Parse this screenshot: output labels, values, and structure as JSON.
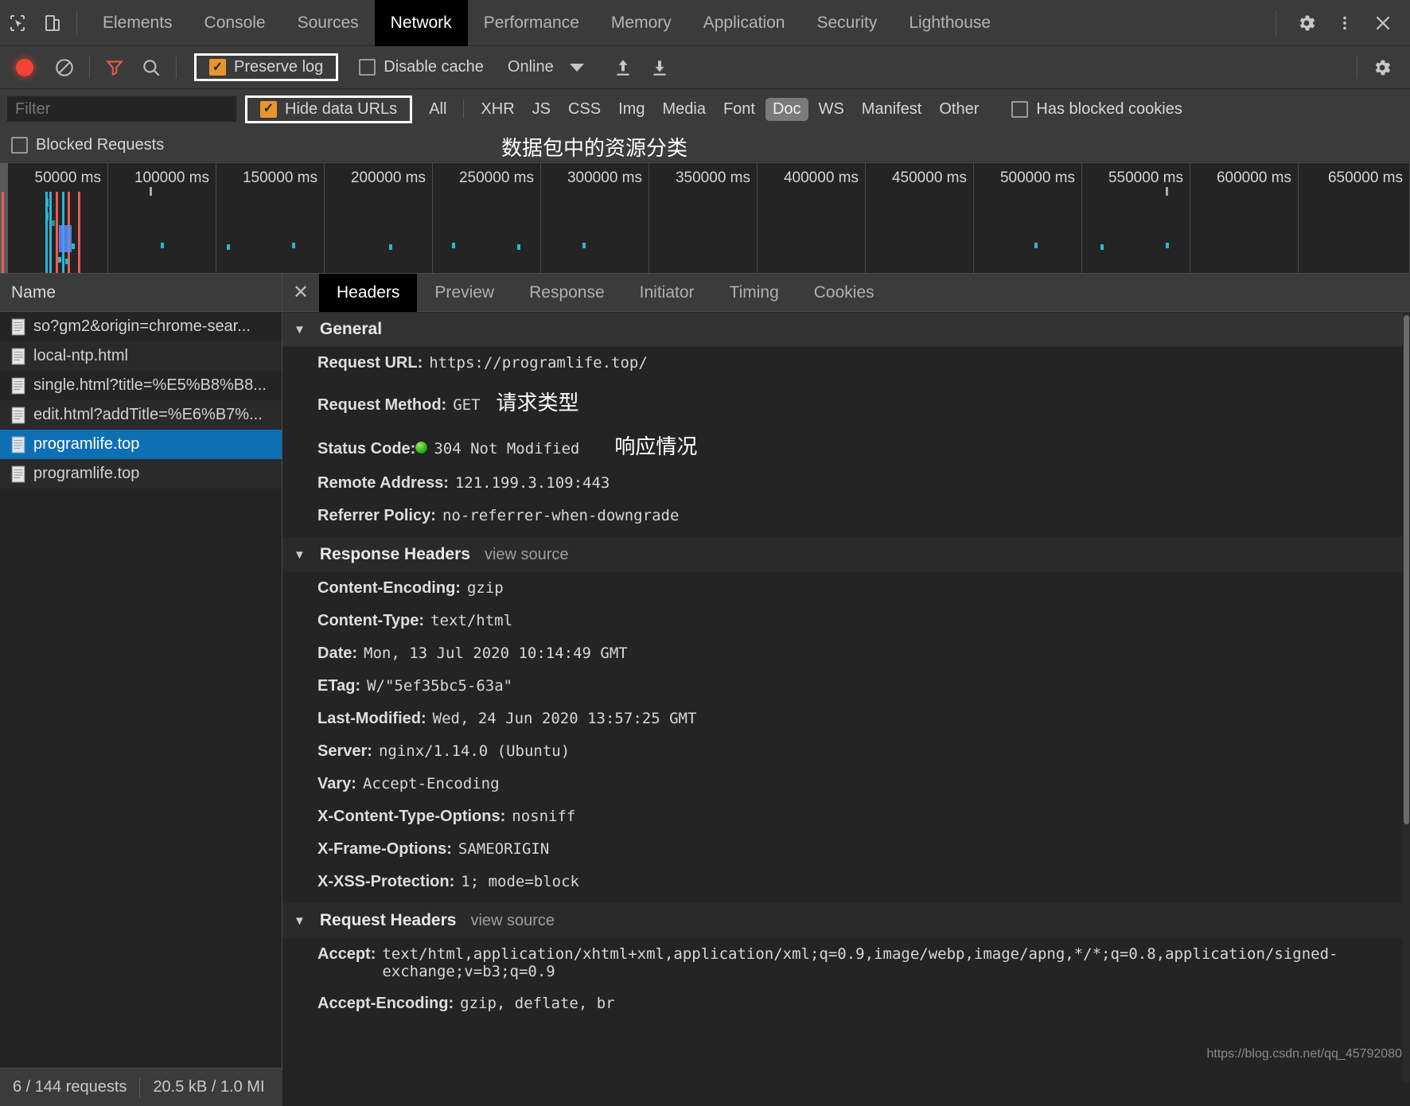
{
  "devtools": {
    "tabs": [
      {
        "label": "Elements",
        "active": false
      },
      {
        "label": "Console",
        "active": false
      },
      {
        "label": "Sources",
        "active": false
      },
      {
        "label": "Network",
        "active": true
      },
      {
        "label": "Performance",
        "active": false
      },
      {
        "label": "Memory",
        "active": false
      },
      {
        "label": "Application",
        "active": false
      },
      {
        "label": "Security",
        "active": false
      },
      {
        "label": "Lighthouse",
        "active": false
      }
    ],
    "icons": {
      "inspect": "inspect-element-icon",
      "device": "device-toolbar-icon",
      "settings": "gear-icon",
      "more": "more-vertical-icon",
      "close": "close-icon"
    }
  },
  "controls": {
    "record_title": "record-button",
    "clear_title": "clear-button",
    "filter_title": "filter-toggle",
    "search_title": "search-button",
    "preserve_log": {
      "label": "Preserve log",
      "checked": true,
      "highlighted": true
    },
    "disable_cache": {
      "label": "Disable cache",
      "checked": false
    },
    "throttle": {
      "value": "Online"
    },
    "import_title": "import-har-icon",
    "export_title": "export-har-icon",
    "settings_title": "network-settings-gear-icon"
  },
  "filterbar": {
    "placeholder": "Filter",
    "value": "",
    "hide_data_urls": {
      "label": "Hide data URLs",
      "checked": true,
      "highlighted": true
    },
    "types": [
      {
        "label": "All",
        "selected": false
      },
      {
        "label": "XHR",
        "selected": false
      },
      {
        "label": "JS",
        "selected": false
      },
      {
        "label": "CSS",
        "selected": false
      },
      {
        "label": "Img",
        "selected": false
      },
      {
        "label": "Media",
        "selected": false
      },
      {
        "label": "Font",
        "selected": false
      },
      {
        "label": "Doc",
        "selected": true
      },
      {
        "label": "WS",
        "selected": false
      },
      {
        "label": "Manifest",
        "selected": false
      },
      {
        "label": "Other",
        "selected": false
      }
    ],
    "has_blocked_cookies": {
      "label": "Has blocked cookies",
      "checked": false
    },
    "blocked_requests": {
      "label": "Blocked Requests",
      "checked": false
    },
    "annotation_resource_types": "数据包中的资源分类"
  },
  "overview": {
    "ticks": [
      "50000 ms",
      "100000 ms",
      "150000 ms",
      "200000 ms",
      "250000 ms",
      "300000 ms",
      "350000 ms",
      "400000 ms",
      "450000 ms",
      "500000 ms",
      "550000 ms",
      "600000 ms",
      "650000 ms"
    ]
  },
  "requests": {
    "column_header": "Name",
    "rows": [
      {
        "name": "so?gm2&origin=chrome-sear...",
        "selected": false
      },
      {
        "name": "local-ntp.html",
        "selected": false
      },
      {
        "name": "single.html?title=%E5%B8%B8...",
        "selected": false
      },
      {
        "name": "edit.html?addTitle=%E6%B7%...",
        "selected": false
      },
      {
        "name": "programlife.top",
        "selected": true
      },
      {
        "name": "programlife.top",
        "selected": false
      }
    ]
  },
  "details": {
    "tabs": [
      {
        "label": "Headers",
        "active": true
      },
      {
        "label": "Preview",
        "active": false
      },
      {
        "label": "Response",
        "active": false
      },
      {
        "label": "Initiator",
        "active": false
      },
      {
        "label": "Timing",
        "active": false
      },
      {
        "label": "Cookies",
        "active": false
      }
    ],
    "general": {
      "title": "General",
      "request_url": {
        "key": "Request URL:",
        "value": "https://programlife.top/"
      },
      "request_method": {
        "key": "Request Method:",
        "value": "GET",
        "annotation": "请求类型"
      },
      "status_code": {
        "key": "Status Code:",
        "value": "304 Not Modified",
        "annotation": "响应情况",
        "dot_color": "#22b000"
      },
      "remote_address": {
        "key": "Remote Address:",
        "value": "121.199.3.109:443"
      },
      "referrer_policy": {
        "key": "Referrer Policy:",
        "value": "no-referrer-when-downgrade"
      }
    },
    "response_headers": {
      "title": "Response Headers",
      "view_source": "view source",
      "items": [
        {
          "key": "Content-Encoding:",
          "value": "gzip"
        },
        {
          "key": "Content-Type:",
          "value": "text/html"
        },
        {
          "key": "Date:",
          "value": "Mon, 13 Jul 2020 10:14:49 GMT"
        },
        {
          "key": "ETag:",
          "value": "W/\"5ef35bc5-63a\""
        },
        {
          "key": "Last-Modified:",
          "value": "Wed, 24 Jun 2020 13:57:25 GMT"
        },
        {
          "key": "Server:",
          "value": "nginx/1.14.0 (Ubuntu)"
        },
        {
          "key": "Vary:",
          "value": "Accept-Encoding"
        },
        {
          "key": "X-Content-Type-Options:",
          "value": "nosniff"
        },
        {
          "key": "X-Frame-Options:",
          "value": "SAMEORIGIN"
        },
        {
          "key": "X-XSS-Protection:",
          "value": "1; mode=block"
        }
      ]
    },
    "request_headers": {
      "title": "Request Headers",
      "view_source": "view source",
      "items": [
        {
          "key": "Accept:",
          "value": "text/html,application/xhtml+xml,application/xml;q=0.9,image/webp,image/apng,*/*;q=0.8,application/signed-exchange;v=b3;q=0.9"
        },
        {
          "key": "Accept-Encoding:",
          "value": "gzip, deflate, br"
        }
      ]
    }
  },
  "statusbar": {
    "requests": "6 / 144 requests",
    "transferred": "20.5 kB / 1.0 MI"
  },
  "watermark": "https://blog.csdn.net/qq_45792080"
}
